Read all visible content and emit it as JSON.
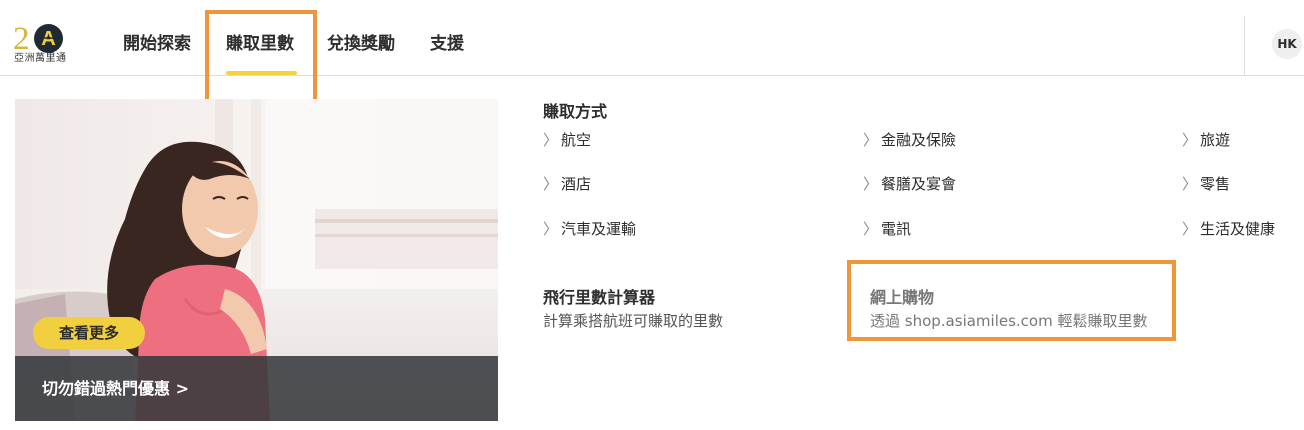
{
  "brand": {
    "logo_number": "2",
    "logo_letter": "A",
    "logo_subtitle": "亞洲萬里通",
    "accent_color": "#f5d23c",
    "highlight_color": "#f0963a"
  },
  "nav": {
    "items": [
      {
        "label": "開始探索"
      },
      {
        "label": "賺取里數",
        "active": true
      },
      {
        "label": "兌換獎勵"
      },
      {
        "label": "支援"
      }
    ]
  },
  "header": {
    "language": "HK"
  },
  "promo": {
    "button_label": "查看更多",
    "link_label": "切勿錯過熱門優惠 >"
  },
  "earn": {
    "title": "賺取方式",
    "categories": [
      {
        "label": "航空"
      },
      {
        "label": "金融及保險"
      },
      {
        "label": "旅遊"
      },
      {
        "label": "酒店"
      },
      {
        "label": "餐膳及宴會"
      },
      {
        "label": "零售"
      },
      {
        "label": "汽車及運輸"
      },
      {
        "label": "電訊"
      },
      {
        "label": "生活及健康"
      }
    ],
    "calculator": {
      "title": "飛行里數計算器",
      "description": "計算乘搭航班可賺取的里數"
    },
    "online_shopping": {
      "title": "網上購物",
      "description": "透過 shop.asiamiles.com 輕鬆賺取里數"
    }
  },
  "icons": {
    "chevron": "chevron-right-icon",
    "logo": "asia-miles-logo"
  }
}
